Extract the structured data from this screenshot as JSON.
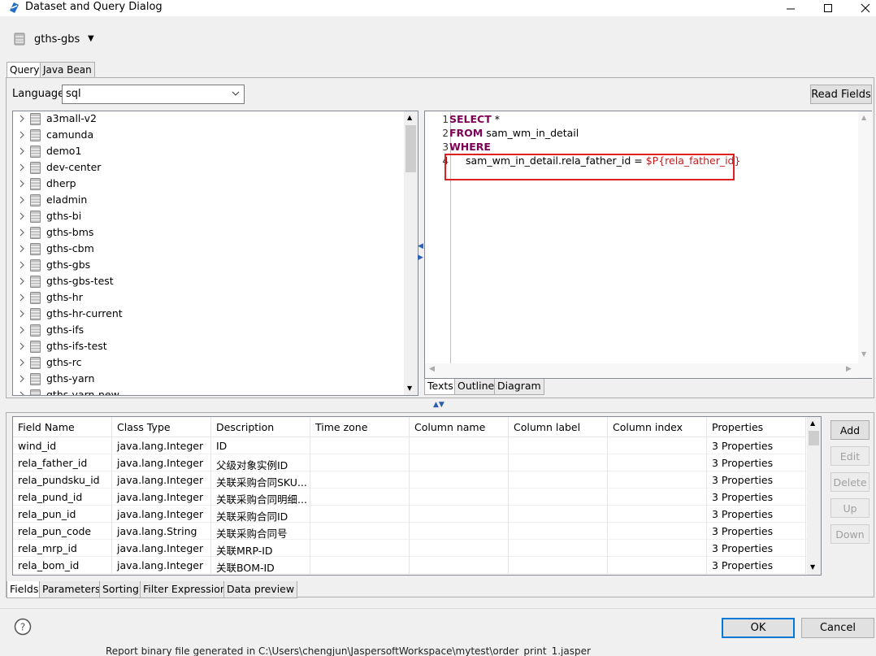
{
  "window": {
    "title": "Dataset and Query Dialog"
  },
  "datasource": {
    "name": "gths-gbs"
  },
  "top_tabs": [
    {
      "label": "Query",
      "active": true
    },
    {
      "label": "Java Bean",
      "active": false
    }
  ],
  "language": {
    "label": "Language",
    "value": "sql"
  },
  "read_fields_label": "Read Fields",
  "schemas": [
    "a3mall-v2",
    "camunda",
    "demo1",
    "dev-center",
    "dherp",
    "eladmin",
    "gths-bi",
    "gths-bms",
    "gths-cbm",
    "gths-gbs",
    "gths-gbs-test",
    "gths-hr",
    "gths-hr-current",
    "gths-ifs",
    "gths-ifs-test",
    "gths-rc",
    "gths-yarn",
    "gths-yarn-new"
  ],
  "editor": {
    "line_numbers": [
      "1",
      "2",
      "3",
      "4"
    ],
    "line1_kw": "SELECT",
    "line1_rest": " *",
    "line2_kw": "FROM",
    "line2_rest": " sam_wm_in_detail",
    "line3_kw": "WHERE",
    "line4_plain": "sam_wm_in_detail.rela_father_id = ",
    "line4_param": "$P{rela_father_id}"
  },
  "editor_tabs": [
    "Texts",
    "Outline",
    "Diagram"
  ],
  "fields_table": {
    "columns": [
      "Field Name",
      "Class Type",
      "Description",
      "Time zone",
      "Column name",
      "Column label",
      "Column index",
      "Properties"
    ],
    "rows": [
      [
        "wind_id",
        "java.lang.Integer",
        "ID",
        "",
        "",
        "",
        "",
        "3 Properties"
      ],
      [
        "rela_father_id",
        "java.lang.Integer",
        "父级对象实例ID",
        "",
        "",
        "",
        "",
        "3 Properties"
      ],
      [
        "rela_pundsku_id",
        "java.lang.Integer",
        "关联采购合同SKU...",
        "",
        "",
        "",
        "",
        "3 Properties"
      ],
      [
        "rela_pund_id",
        "java.lang.Integer",
        "关联采购合同明细...",
        "",
        "",
        "",
        "",
        "3 Properties"
      ],
      [
        "rela_pun_id",
        "java.lang.Integer",
        "关联采购合同ID",
        "",
        "",
        "",
        "",
        "3 Properties"
      ],
      [
        "rela_pun_code",
        "java.lang.String",
        "关联采购合同号",
        "",
        "",
        "",
        "",
        "3 Properties"
      ],
      [
        "rela_mrp_id",
        "java.lang.Integer",
        "关联MRP-ID",
        "",
        "",
        "",
        "",
        "3 Properties"
      ],
      [
        "rela_bom_id",
        "java.lang.Integer",
        "关联BOM-ID",
        "",
        "",
        "",
        "",
        "3 Properties"
      ]
    ]
  },
  "side_buttons": {
    "add": "Add",
    "edit": "Edit",
    "delete": "Delete",
    "up": "Up",
    "down": "Down"
  },
  "bottom_tabs": [
    "Fields",
    "Parameters",
    "Sorting",
    "Filter Expression",
    "Data preview"
  ],
  "footer": {
    "ok": "OK",
    "cancel": "Cancel"
  },
  "status_text": "Report binary file generated in C:\\Users\\chengjun\\JaspersoftWorkspace\\mytest\\order_print_1.jasper",
  "colors": {
    "keyword": "#7f0055",
    "parameter": "#c02020",
    "highlight_box": "#e02020",
    "ok_border": "#0078d7"
  }
}
